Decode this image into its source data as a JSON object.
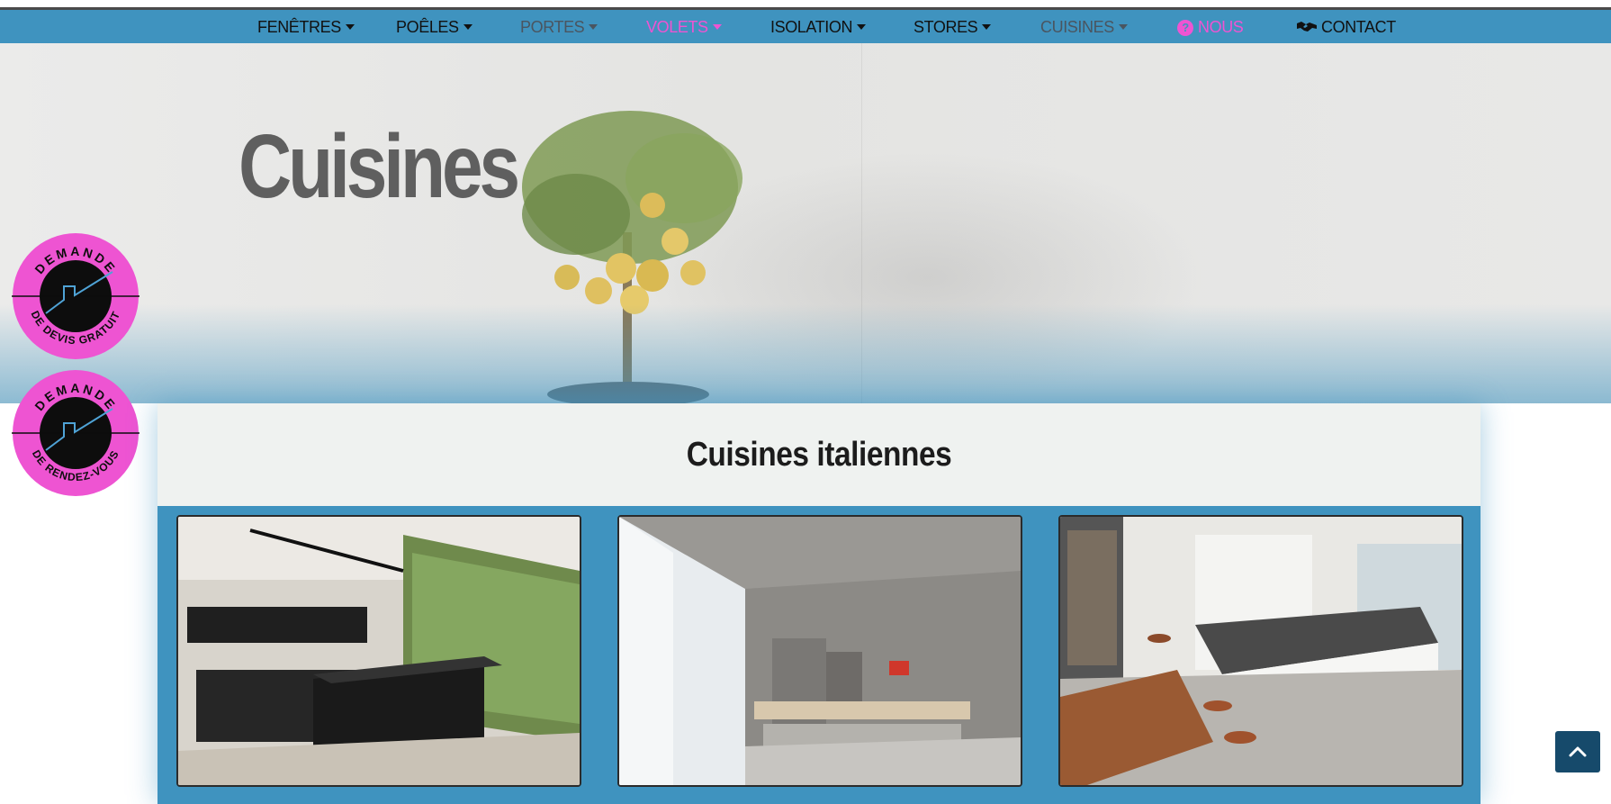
{
  "nav": {
    "items": [
      {
        "label": "FENÊTRES",
        "dropdown": true
      },
      {
        "label": "POÊLES",
        "dropdown": true
      },
      {
        "label": "PORTES",
        "dropdown": true
      },
      {
        "label": "VOLETS",
        "dropdown": true
      },
      {
        "label": "ISOLATION",
        "dropdown": true
      },
      {
        "label": "STORES",
        "dropdown": true
      },
      {
        "label": "CUISINES",
        "dropdown": true
      },
      {
        "label": "NOUS",
        "icon": "question-circle-icon"
      },
      {
        "label": "CONTACT",
        "icon": "handshake-icon"
      }
    ]
  },
  "hero": {
    "title": "Cuisines"
  },
  "badges": [
    {
      "top": "DEMANDE",
      "bottom": "DE DEVIS GRATUIT"
    },
    {
      "top": "DEMANDE",
      "bottom": "DE RENDEZ-VOUS"
    }
  ],
  "section": {
    "title": "Cuisines italiennes",
    "images": [
      "kitchen-photo-black-island",
      "kitchen-photo-grey-modern",
      "kitchen-photo-white-island"
    ]
  },
  "scroll_top": {
    "icon": "chevron-up-icon"
  },
  "colors": {
    "nav_bg": "#3f93bf",
    "accent_pink": "#ee54d2",
    "section_head_bg": "#eff2f0",
    "scroll_top_bg": "#164a6b"
  }
}
